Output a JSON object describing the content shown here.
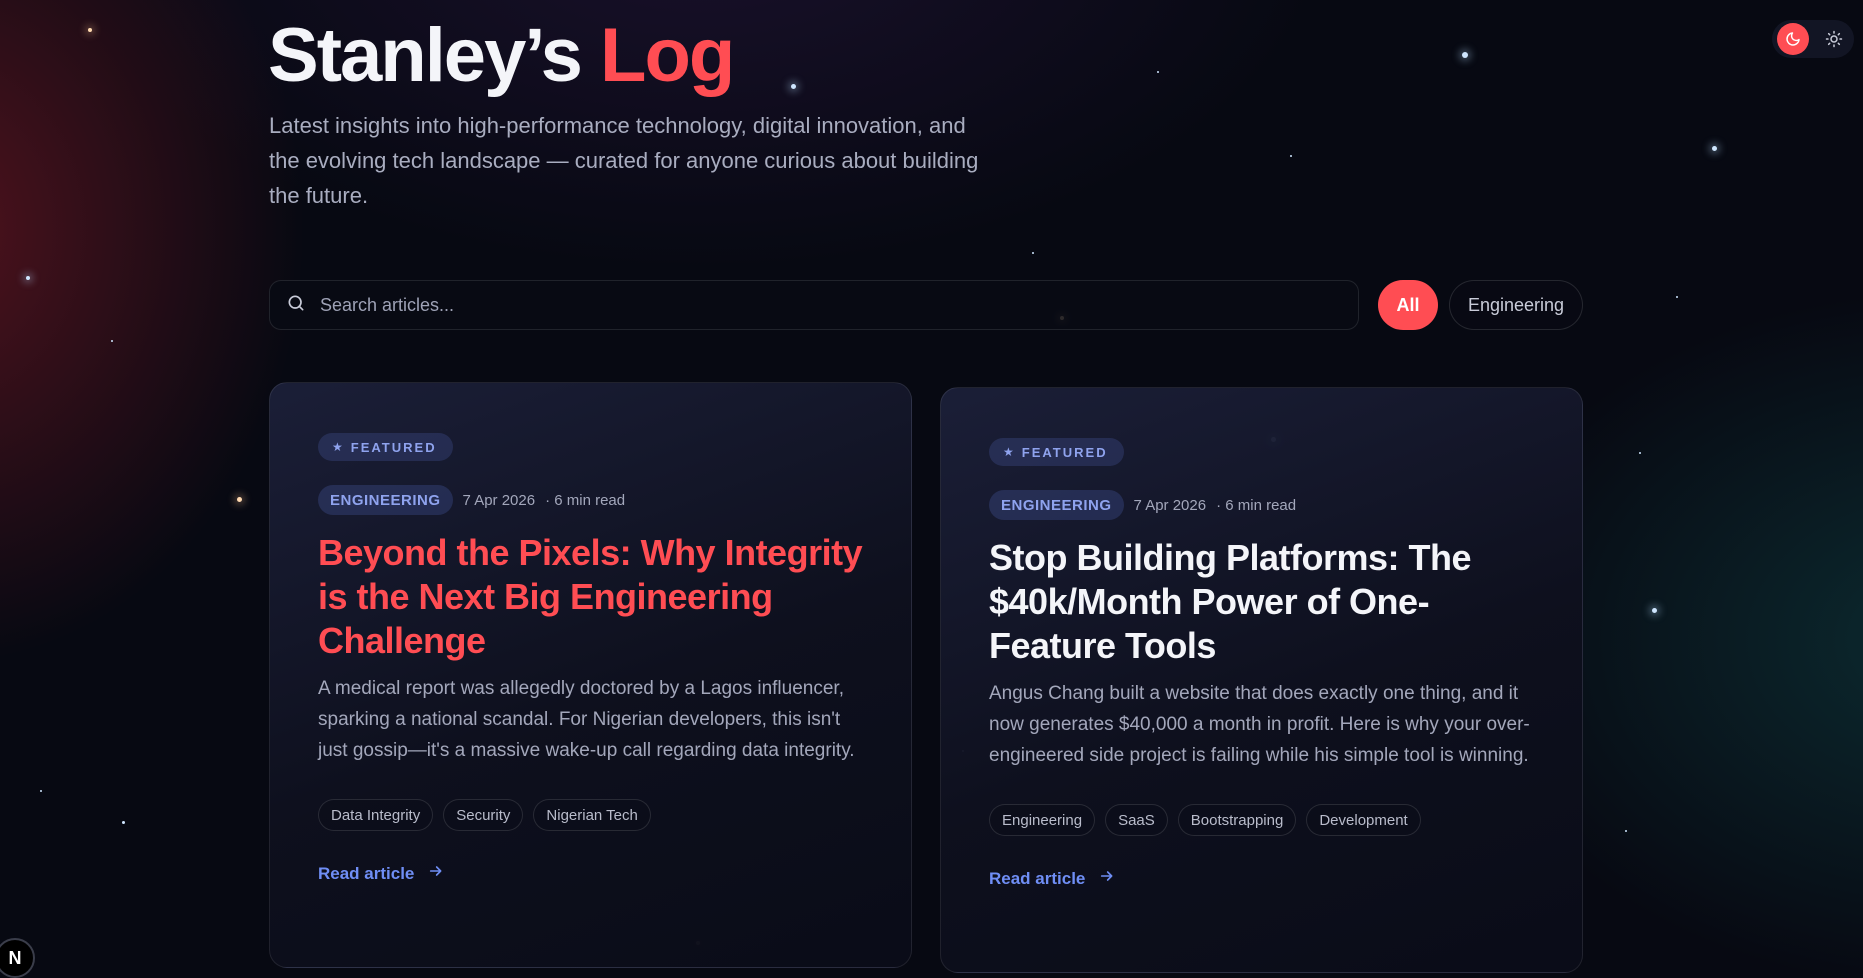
{
  "header": {
    "title_main": "Stanley’s",
    "title_accent": "Log",
    "description": "Latest insights into high-performance technology, digital innovation, and the evolving tech landscape — curated for anyone curious about building the future."
  },
  "theme_toggle": {
    "dark_icon": "moon-icon",
    "light_icon": "sun-icon",
    "active": "dark"
  },
  "search": {
    "placeholder": "Search articles...",
    "value": "",
    "icon": "search-icon"
  },
  "filters": [
    {
      "label": "All",
      "active": true
    },
    {
      "label": "Engineering",
      "active": false
    }
  ],
  "articles": [
    {
      "featured_label": "FEATURED",
      "category": "ENGINEERING",
      "date": "7 Apr 2026",
      "read_time": "· 6 min read",
      "title": "Beyond the Pixels: Why Integrity is the Next Big Engineering Challenge",
      "excerpt": "A medical report was allegedly doctored by a Lagos influencer, sparking a national scandal. For Nigerian developers, this isn't just gossip—it's a massive wake-up call regarding data integrity.",
      "tags": [
        "Data Integrity",
        "Security",
        "Nigerian Tech"
      ],
      "cta": "Read article"
    },
    {
      "featured_label": "FEATURED",
      "category": "ENGINEERING",
      "date": "7 Apr 2026",
      "read_time": "· 6 min read",
      "title": "Stop Building Platforms: The $40k/Month Power of One-Feature Tools",
      "excerpt": "Angus Chang built a website that does exactly one thing, and it now generates $40,000 a month in profit. Here is why your over-engineered side project is failing while his simple tool is winning.",
      "tags": [
        "Engineering",
        "SaaS",
        "Bootstrapping",
        "Development"
      ],
      "cta": "Read article"
    }
  ],
  "corner_badge": {
    "letter": "N"
  },
  "colors": {
    "accent": "#ff4d53",
    "link": "#6f8ef5",
    "badge_text": "#8fa3ee",
    "background": "#070912"
  }
}
